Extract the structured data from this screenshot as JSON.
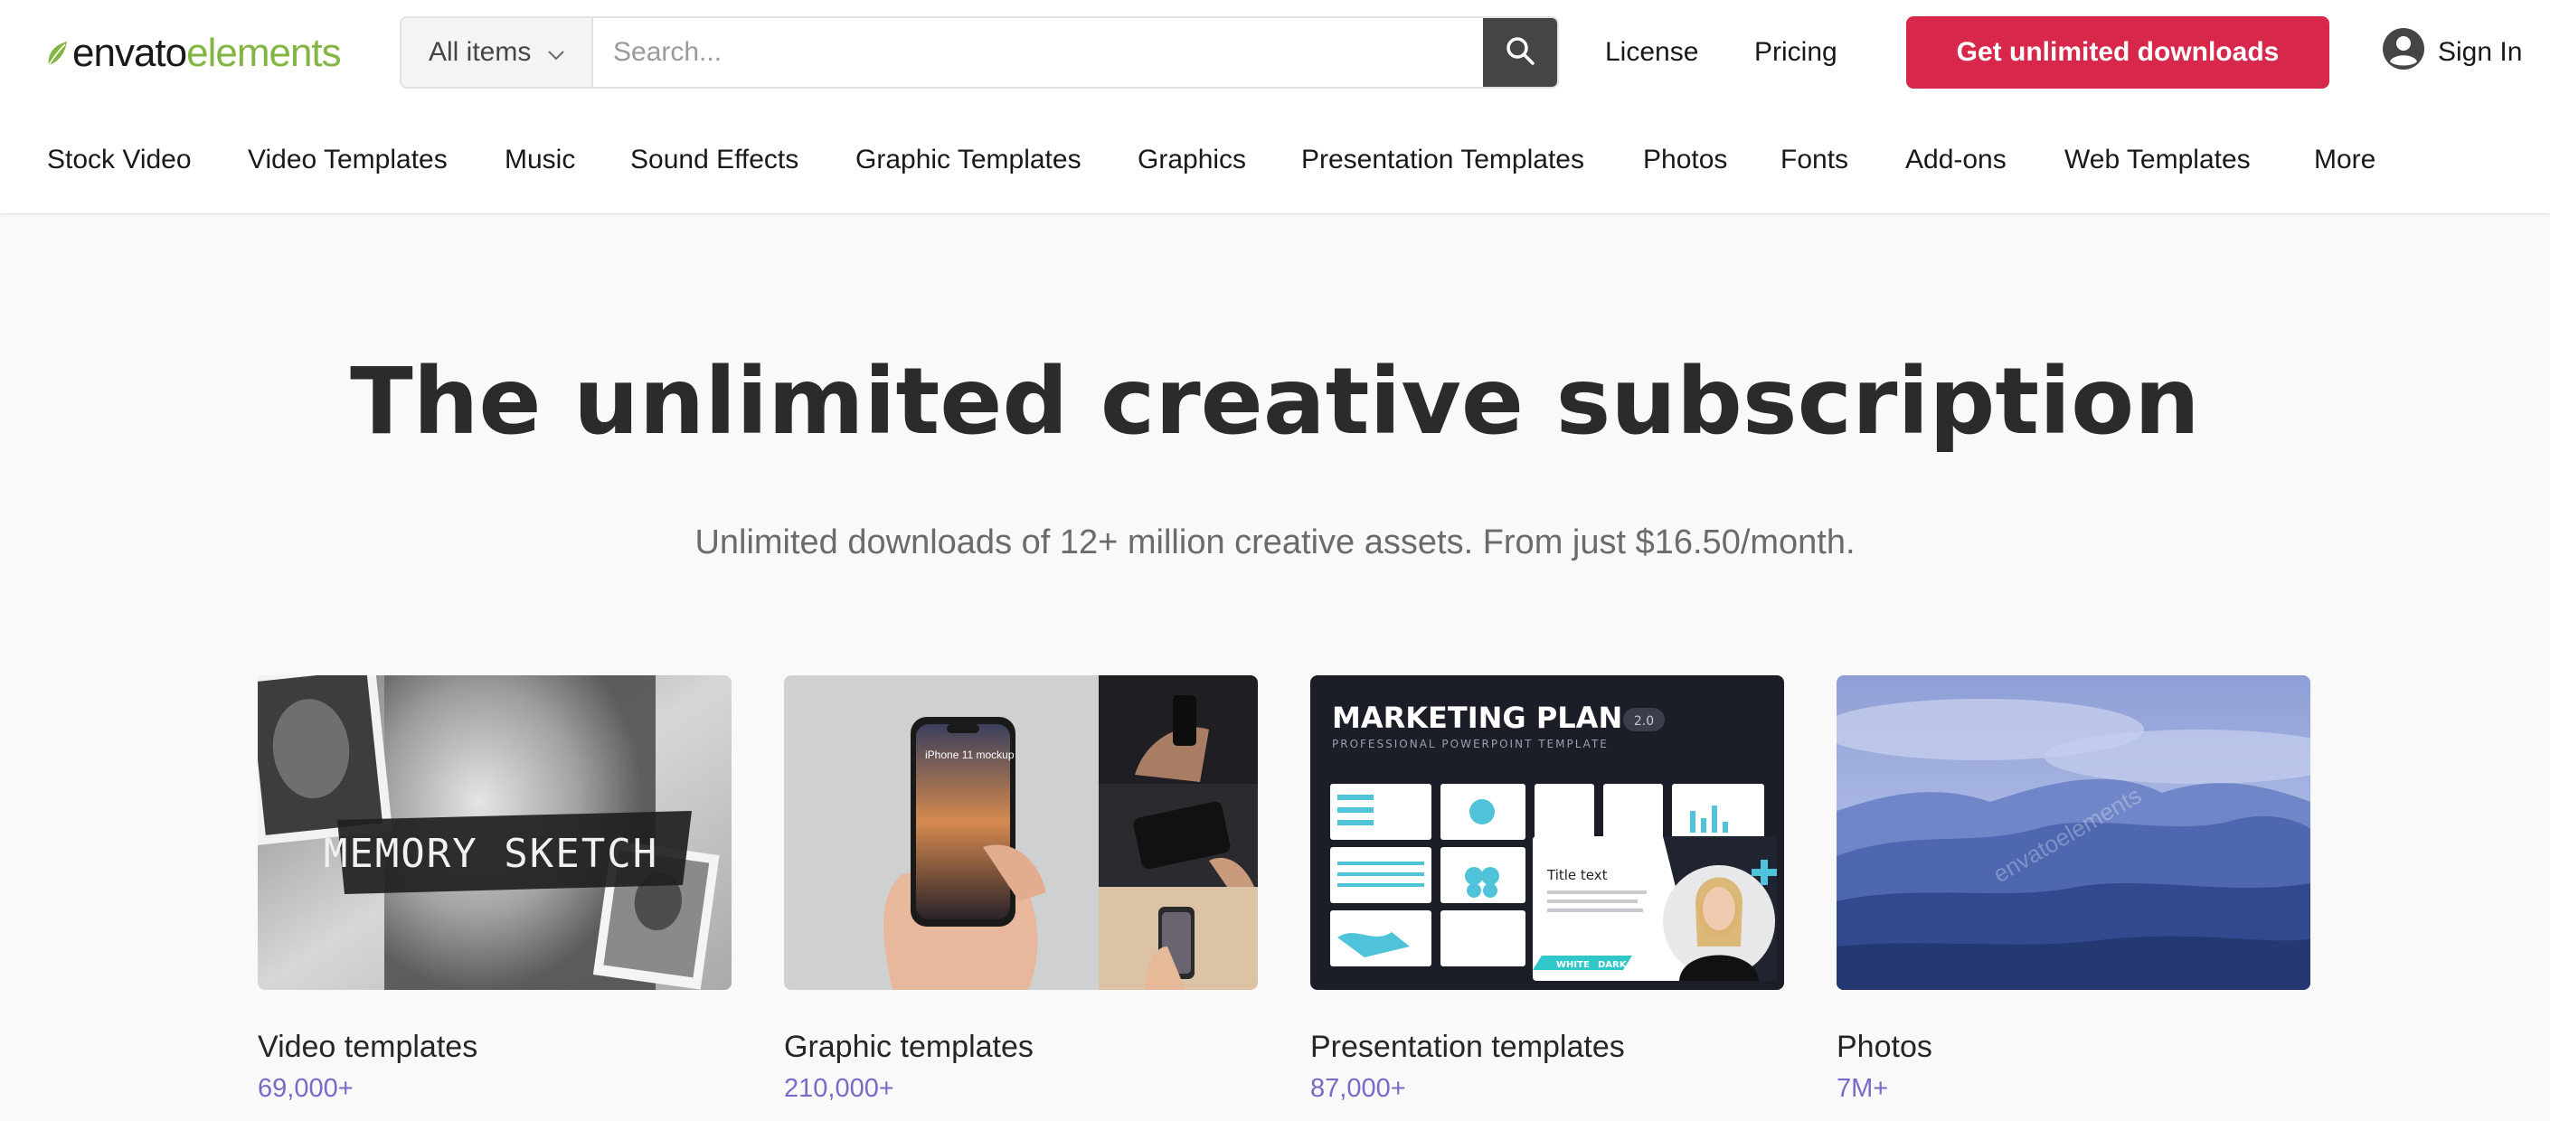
{
  "brand": {
    "word1": "envato",
    "word2": "elements",
    "leaf_icon": "leaf-icon",
    "colors": {
      "green": "#82b541",
      "dark": "#191919"
    }
  },
  "search": {
    "category_label": "All items",
    "placeholder": "Search...",
    "value": ""
  },
  "header": {
    "license": "License",
    "pricing": "Pricing",
    "cta": "Get unlimited downloads",
    "sign_in": "Sign In",
    "cta_color": "#d7284b"
  },
  "nav": {
    "items": [
      "Stock Video",
      "Video Templates",
      "Music",
      "Sound Effects",
      "Graphic Templates",
      "Graphics",
      "Presentation Templates",
      "Photos",
      "Fonts",
      "Add-ons",
      "Web Templates",
      "More"
    ]
  },
  "hero": {
    "title": "The unlimited creative subscription",
    "subtitle": "Unlimited downloads of 12+ million creative assets. From just $16.50/month."
  },
  "cards": [
    {
      "title": "Video templates",
      "count": "69,000+",
      "thumb_text": "MEMORY SKETCH"
    },
    {
      "title": "Graphic templates",
      "count": "210,000+",
      "thumb_text": "iPhone 11 mockup"
    },
    {
      "title": "Presentation templates",
      "count": "87,000+",
      "thumb_heading": "MARKETING PLAN",
      "thumb_badge": "2.0",
      "thumb_subheading": "PROFESSIONAL POWERPOINT TEMPLATE",
      "thumb_slide_title": "Title text",
      "thumb_tag_white": "WHITE",
      "thumb_tag_dark": "DARK"
    },
    {
      "title": "Photos",
      "count": "7M+",
      "watermark": "envatoelements"
    }
  ]
}
